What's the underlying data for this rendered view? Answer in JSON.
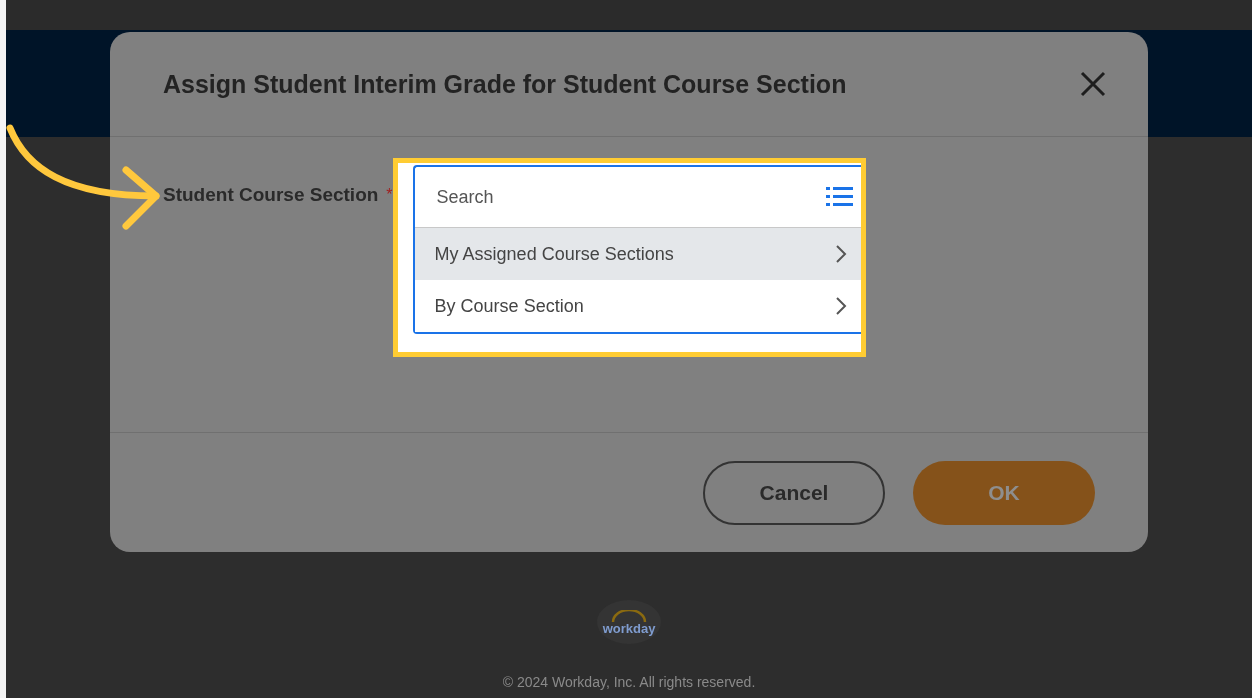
{
  "dialog": {
    "title": "Assign Student Interim Grade for Student Course Section",
    "field": {
      "label": "Student Course Section",
      "required": true,
      "required_mark": "*",
      "placeholder": "Search",
      "options": [
        {
          "label": "My Assigned Course Sections",
          "selected": true
        },
        {
          "label": "By Course Section",
          "selected": false
        }
      ]
    },
    "buttons": [
      {
        "label": "Cancel",
        "kind": "secondary"
      },
      {
        "label": "OK",
        "kind": "primary"
      }
    ]
  },
  "footer": {
    "logo_text": "workday",
    "copyright": "© 2024 Workday, Inc. All rights reserved."
  }
}
